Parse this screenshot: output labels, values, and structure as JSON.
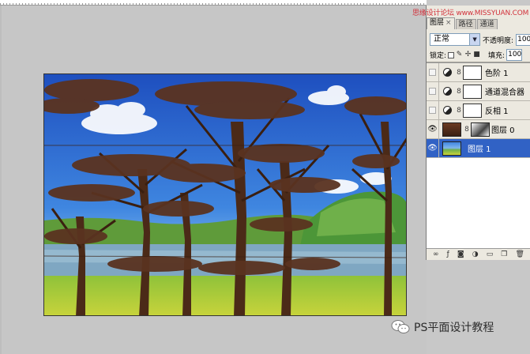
{
  "watermark": "思缘设计论坛 www.MISSYUAN.COM",
  "tabs": [
    {
      "label": "图层",
      "close": "×"
    },
    {
      "label": "路径"
    },
    {
      "label": "通道"
    }
  ],
  "blend_mode": "正常",
  "opacity_label": "不透明度:",
  "opacity_value": "100",
  "lock_label": "锁定:",
  "fill_label": "填充:",
  "fill_value": "100",
  "layers": [
    {
      "name": "色阶 1",
      "visible": false,
      "kind": "adjustment",
      "selected": false
    },
    {
      "name": "通道混合器",
      "visible": false,
      "kind": "adjustment",
      "selected": false
    },
    {
      "name": "反相 1",
      "visible": false,
      "kind": "adjustment",
      "selected": false
    },
    {
      "name": "图层 0",
      "visible": true,
      "kind": "image-mask",
      "selected": false
    },
    {
      "name": "图层 1",
      "visible": true,
      "kind": "image",
      "selected": true
    }
  ],
  "brand": "PS平面设计教程",
  "icons": {
    "visibility": "eye-icon",
    "adjustment": "adjustment-layer-icon",
    "link": "chain-link-icon",
    "wechat": "wechat-icon"
  },
  "colors": {
    "selected_layer": "#3162c5",
    "panel_bg": "#ece9e0",
    "workspace": "#c6c6c6",
    "watermark": "#d2323c"
  }
}
